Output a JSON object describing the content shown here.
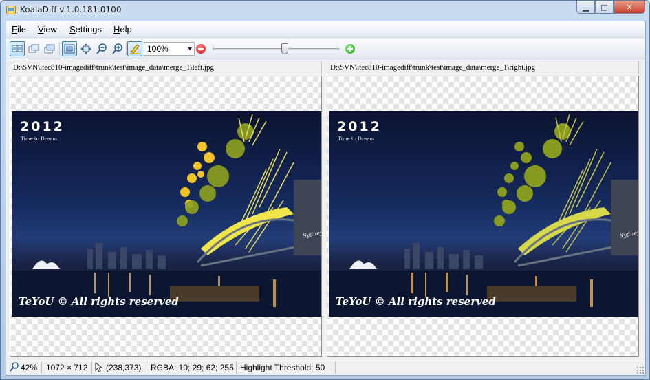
{
  "window": {
    "title": "KoalaDiff v.1.0.181.0100"
  },
  "caption": {
    "minimize": "▁",
    "maximize": "□",
    "close": "✕"
  },
  "menu": [
    {
      "label": "File",
      "accel": "F"
    },
    {
      "label": "View",
      "accel": "V"
    },
    {
      "label": "Settings",
      "accel": "S"
    },
    {
      "label": "Help",
      "accel": "H"
    }
  ],
  "toolbar": {
    "zoom_value": "100%",
    "zoom_slider_fraction": 0.57,
    "buttons": [
      {
        "name": "side-by-side-view",
        "icon": "side-by-side-icon",
        "active": true
      },
      {
        "name": "overlay-view",
        "icon": "overlay-icon",
        "active": false
      },
      {
        "name": "stacked-view",
        "icon": "stacked-icon",
        "active": false
      },
      {
        "name": "fit-to-window",
        "icon": "fit-window-icon",
        "active": true
      },
      {
        "name": "actual-size",
        "icon": "move-icon",
        "active": false
      },
      {
        "name": "zoom-out",
        "icon": "zoom-out-icon",
        "active": false
      },
      {
        "name": "zoom-in",
        "icon": "zoom-in-icon",
        "active": false
      },
      {
        "name": "highlight-differences",
        "icon": "highlighter-icon",
        "active": true
      }
    ]
  },
  "panes": {
    "left": {
      "path": "D:\\SVN\\itec810-imagediff\\trunk\\test\\image_data\\merge_1\\left.jpg"
    },
    "right": {
      "path": "D:\\SVN\\itec810-imagediff\\trunk\\test\\image_data\\merge_1\\right.jpg"
    }
  },
  "image": {
    "year": "2012",
    "subtitle": "Time to Dream",
    "copyright": "TeYoU © All rights reserved",
    "landmark_text": "Sydney"
  },
  "status": {
    "zoom": "42%",
    "dimensions": "1072 × 712",
    "cursor": "(238,373)",
    "rgba": "RGBA: 10; 29; 62; 255",
    "threshold": "Highlight Threshold: 50"
  },
  "colors": {
    "accent": "#3c7fb1",
    "minus": "#d30d0d",
    "plus": "#1a9b12"
  }
}
